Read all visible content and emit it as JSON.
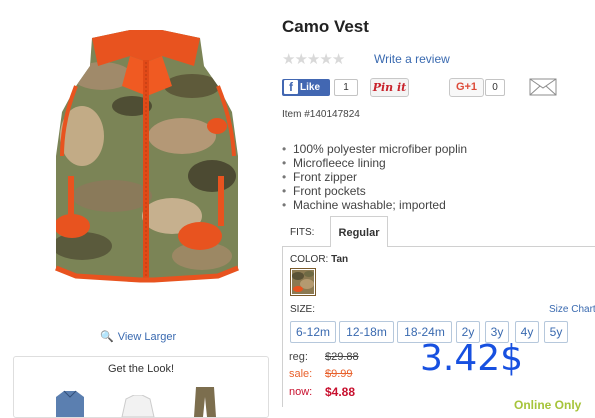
{
  "product": {
    "title": "Camo Vest",
    "write_review": "Write a review",
    "item_number": "Item #140147824",
    "view_larger": "View Larger",
    "features": [
      "100% polyester microfiber poplin",
      "Microfleece lining",
      "Front zipper",
      "Front pockets",
      "Machine washable; imported"
    ]
  },
  "social": {
    "like_label": "Like",
    "like_count": "1",
    "pinit_label": "Pin it",
    "gplus_label": "G+1",
    "gplus_count": "0"
  },
  "fits": {
    "label": "FITS:",
    "selected": "Regular"
  },
  "color": {
    "label": "COLOR:",
    "value": "Tan"
  },
  "size": {
    "label": "SIZE:",
    "chart_link": "Size Chart",
    "options": [
      "6-12m",
      "12-18m",
      "18-24m",
      "2y",
      "3y",
      "4y",
      "5y"
    ]
  },
  "pricing": {
    "reg_label": "reg:",
    "reg_value": "$29.88",
    "sale_label": "sale:",
    "sale_value": "$9.99",
    "now_label": "now:",
    "now_value": "$4.88",
    "overlay_price": "3.42$",
    "online_only": "Online Only"
  },
  "get_the_look": {
    "title": "Get the Look!"
  },
  "colors": {
    "link": "#3a6ab0",
    "sale": "#e8612c",
    "now": "#c8102e",
    "overlay": "#1750e0",
    "online_only": "#a6c43a",
    "facebook": "#4267b2"
  }
}
